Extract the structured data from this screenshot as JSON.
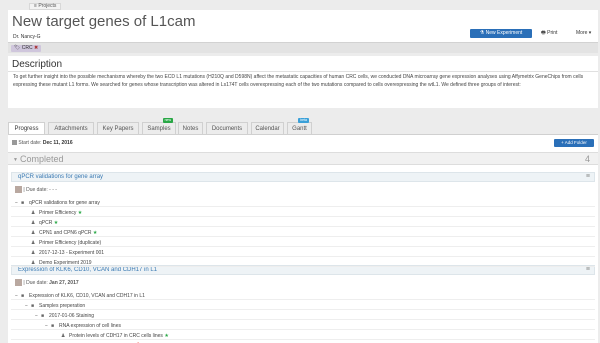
{
  "nav": {
    "projects_label": "Projects"
  },
  "header": {
    "title": "New target genes of L1cam",
    "owner": "Dr. Nancy-G",
    "new_experiment": "New Experiment",
    "print": "Print",
    "more": "More"
  },
  "tag": {
    "label": "CRC"
  },
  "description": {
    "title": "Description",
    "text": "To get further insight into the possible mechanisms whereby the two ECD L1 mutations (H210Q and D598N) affect the metastatic capacities of human CRC cells, we conducted DNA microarray gene expression analyses using Affymetrix GeneChips from cells expressing these mutant L1 forms. We searched for genes whose transcription was altered in Ls174T cells overexpressing each of the two mutations compared to cells overexpressing the wtL1. We defined three groups of interest:"
  },
  "tabs": [
    {
      "label": "Progress"
    },
    {
      "label": "Attachments"
    },
    {
      "label": "Key Papers"
    },
    {
      "label": "Samples",
      "badge": "new",
      "badge_color": "#28a745"
    },
    {
      "label": "Notes"
    },
    {
      "label": "Documents"
    },
    {
      "label": "Calendar"
    },
    {
      "label": "Gantt",
      "badge": "beta",
      "badge_color": "#3aa0d8"
    }
  ],
  "progress": {
    "start_label": "Start date:",
    "start_date": "Dec 11, 2016",
    "add_folder": "+ Add Folder",
    "section_label": "Completed",
    "section_count": "4"
  },
  "experiment1": {
    "title": "qPCR validations for gene array",
    "due_label": "| Due date:",
    "due_value": "- - -",
    "rows": [
      {
        "text": "qPCR validations for gene array",
        "icon": "folder"
      },
      {
        "text": "Primer Efficiency",
        "icon": "person",
        "star": true
      },
      {
        "text": "qPCR",
        "icon": "person",
        "star": true
      },
      {
        "text": "CPN1 and CPN6 qPCR",
        "icon": "person",
        "star": true
      },
      {
        "text": "Primer Efficiency (duplicate)",
        "icon": "person"
      },
      {
        "text": "2017-12-13 - Experiment 001",
        "icon": "person"
      },
      {
        "text": "Demo Experiment 2019",
        "icon": "person"
      }
    ]
  },
  "experiment2": {
    "title": "Expression of KLK6, CD10, VCAN and CDH17 in L1",
    "due_label": "| Due date:",
    "due_value": "Jan 27, 2017",
    "rows": [
      {
        "text": "Expression of KLK6, CD10, VCAN and CDH17 in L1",
        "icon": "folder"
      },
      {
        "text": "Samples preperation",
        "icon": "folder"
      },
      {
        "text": "2017-01-06 Staining",
        "icon": "folder"
      },
      {
        "text": "RNA expression of cell lines",
        "icon": "folder"
      },
      {
        "text": "Protein levels of CDH17 in CRC cells lines",
        "icon": "person",
        "star": true
      },
      {
        "text": "KLK6 staining in LS L1clones",
        "icon": "person",
        "pin": true
      }
    ]
  }
}
